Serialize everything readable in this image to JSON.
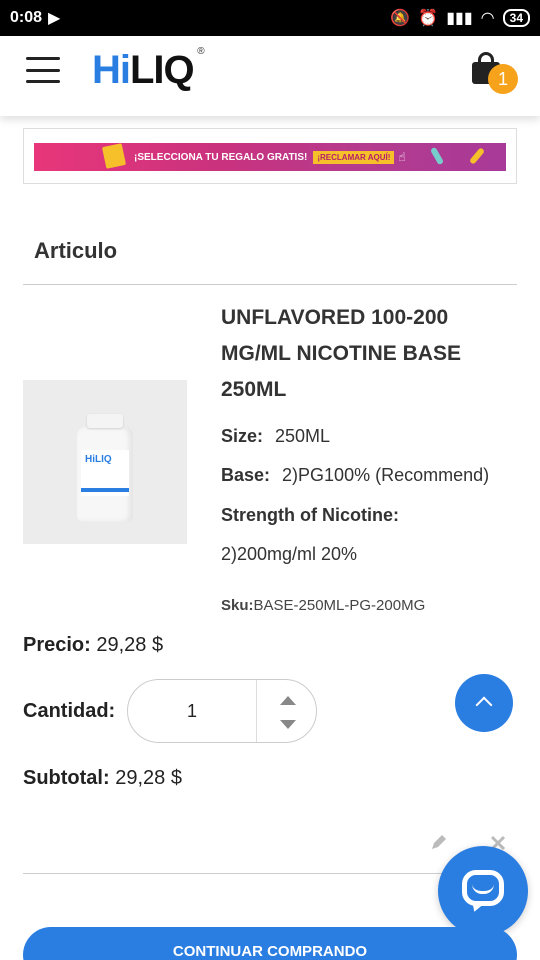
{
  "status_bar": {
    "time": "0:08",
    "battery": "34"
  },
  "header": {
    "logo_hi": "Hi",
    "logo_liq": "LIQ",
    "logo_reg": "®",
    "cart_count": "1"
  },
  "banner": {
    "text": "¡SELECCIONA TU REGALO GRATIS!",
    "cta": "¡RECLAMAR AQUÍ!"
  },
  "section_title": "Articulo",
  "product": {
    "title": "UNFLAVORED 100-200 MG/ML NICOTINE BASE 250ML",
    "image_label": "HiLIQ",
    "attributes": [
      {
        "label": "Size:",
        "value": "250ML"
      },
      {
        "label": "Base:",
        "value": "2)PG100% (Recommend)"
      },
      {
        "label": "Strength of Nicotine:",
        "value": "2)200mg/ml 20%"
      }
    ],
    "sku_label": "Sku:",
    "sku_value": "BASE-250ML-PG-200MG"
  },
  "pricing": {
    "price_label": "Precio:",
    "price_value": "29,28 $",
    "qty_label": "Cantidad:",
    "qty_value": "1",
    "subtotal_label": "Subtotal:",
    "subtotal_value": "29,28 $"
  },
  "actions": {
    "continue_label": "CONTINUAR COMPRANDO"
  },
  "colors": {
    "accent": "#2a7de1",
    "badge": "#f7a21b"
  }
}
